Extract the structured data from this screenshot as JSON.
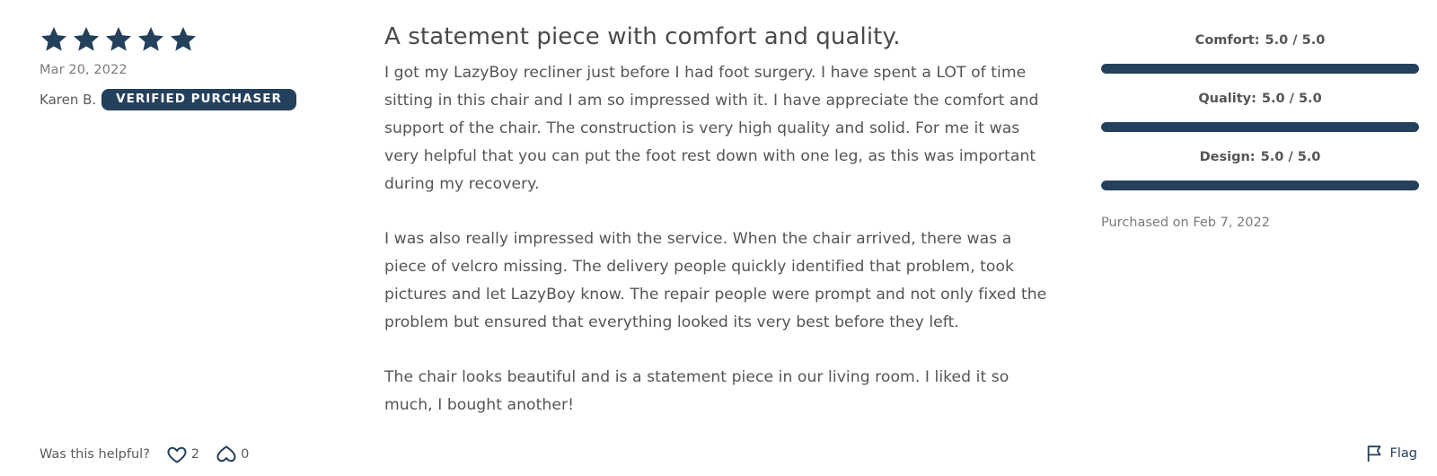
{
  "review": {
    "rating": 5,
    "rating_max": 5,
    "date": "Mar 20, 2022",
    "reviewer_name": "Karen B.",
    "verified_badge": "VERIFIED PURCHASER",
    "title": "A statement piece with comfort and quality.",
    "paragraphs": [
      "I got my LazyBoy recliner just before I had foot surgery. I have spent a LOT of time sitting in this chair and I am so impressed with it. I have appreciate the comfort and support of the chair. The construction is very high quality and solid. For me it was very helpful that you can put the foot rest down with one leg, as this was important during my recovery.",
      "I was also really impressed with the service. When the chair arrived, there was a piece of velcro missing. The delivery people quickly identified that problem, took pictures and let LazyBoy know. The repair people were prompt and not only fixed the problem but ensured that everything looked its very best before they left.",
      "The chair looks beautiful and is a statement piece in our living room. I liked it so much, I bought another!"
    ]
  },
  "ratings": [
    {
      "label": "Comfort:",
      "value": "5.0 / 5.0",
      "fraction": 1.0
    },
    {
      "label": "Quality:",
      "value": "5.0 / 5.0",
      "fraction": 1.0
    },
    {
      "label": "Design:",
      "value": "5.0 / 5.0",
      "fraction": 1.0
    }
  ],
  "purchased": "Purchased on Feb 7, 2022",
  "helpful": {
    "prompt": "Was this helpful?",
    "up_count": "2",
    "down_count": "0",
    "up_icon": "heart-icon",
    "down_icon": "heart-outline-down-icon"
  },
  "flag": {
    "label": "Flag",
    "icon": "flag-icon"
  },
  "colors": {
    "accent": "#23405c",
    "text": "#4a4a4a",
    "muted": "#7a7a7a"
  }
}
